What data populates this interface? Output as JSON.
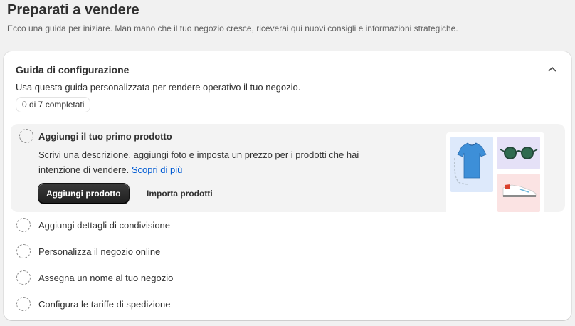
{
  "header": {
    "title": "Preparati a vendere",
    "subtitle": "Ecco una guida per iniziare. Man mano che il tuo negozio cresce, riceverai qui nuovi consigli e informazioni strategiche."
  },
  "guide": {
    "title": "Guida di configurazione",
    "description": "Usa questa guida personalizzata per rendere operativo il tuo negozio.",
    "progress": "0 di 7 completati",
    "collapse_icon": "chevron-up-icon",
    "active_step": {
      "title": "Aggiungi il tuo primo prodotto",
      "description": "Scrivi una descrizione, aggiungi foto e imposta un prezzo per i prodotti che hai intenzione di vendere.",
      "link": "Scopri di più",
      "primary_button": "Aggiungi prodotto",
      "secondary_button": "Importa prodotti"
    },
    "steps": [
      {
        "label": "Aggiungi dettagli di condivisione"
      },
      {
        "label": "Personalizza il negozio online"
      },
      {
        "label": "Assegna un nome al tuo negozio"
      },
      {
        "label": "Configura le tariffe di spedizione"
      }
    ]
  },
  "colors": {
    "background": "#f1f1f1",
    "card": "#ffffff",
    "active_step_bg": "#f3f3f3",
    "link": "#005bd3",
    "primary_button": "#303030"
  }
}
